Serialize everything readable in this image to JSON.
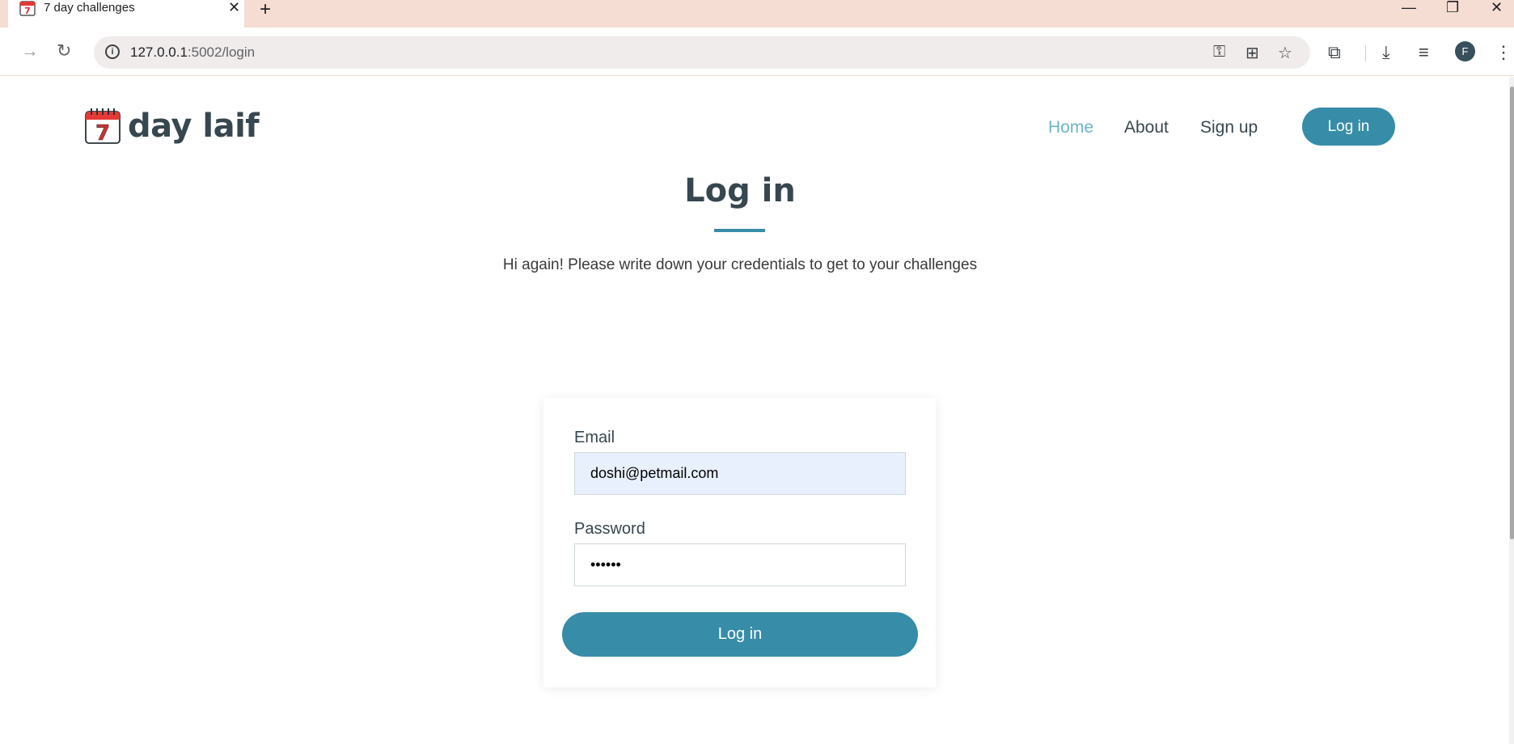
{
  "browser": {
    "tab_title": "7 day challenges",
    "url_host": "127.0.0.1",
    "url_path": ":5002/login",
    "profile_initial": "F"
  },
  "site": {
    "logo_text": "day laif",
    "logo_number": "7",
    "nav": {
      "home": "Home",
      "about": "About",
      "signup": "Sign up",
      "login_button": "Log in"
    }
  },
  "login": {
    "title": "Log in",
    "subtitle": "Hi again! Please write down your credentials to get to your challenges",
    "email_label": "Email",
    "email_value": "doshi@petmail.com",
    "password_label": "Password",
    "password_value": "••••••",
    "submit_label": "Log in"
  },
  "colors": {
    "accent": "#378ca8",
    "nav_active": "#6bb6c6",
    "text": "#37474f",
    "tabbar": "#f5ddd3"
  }
}
